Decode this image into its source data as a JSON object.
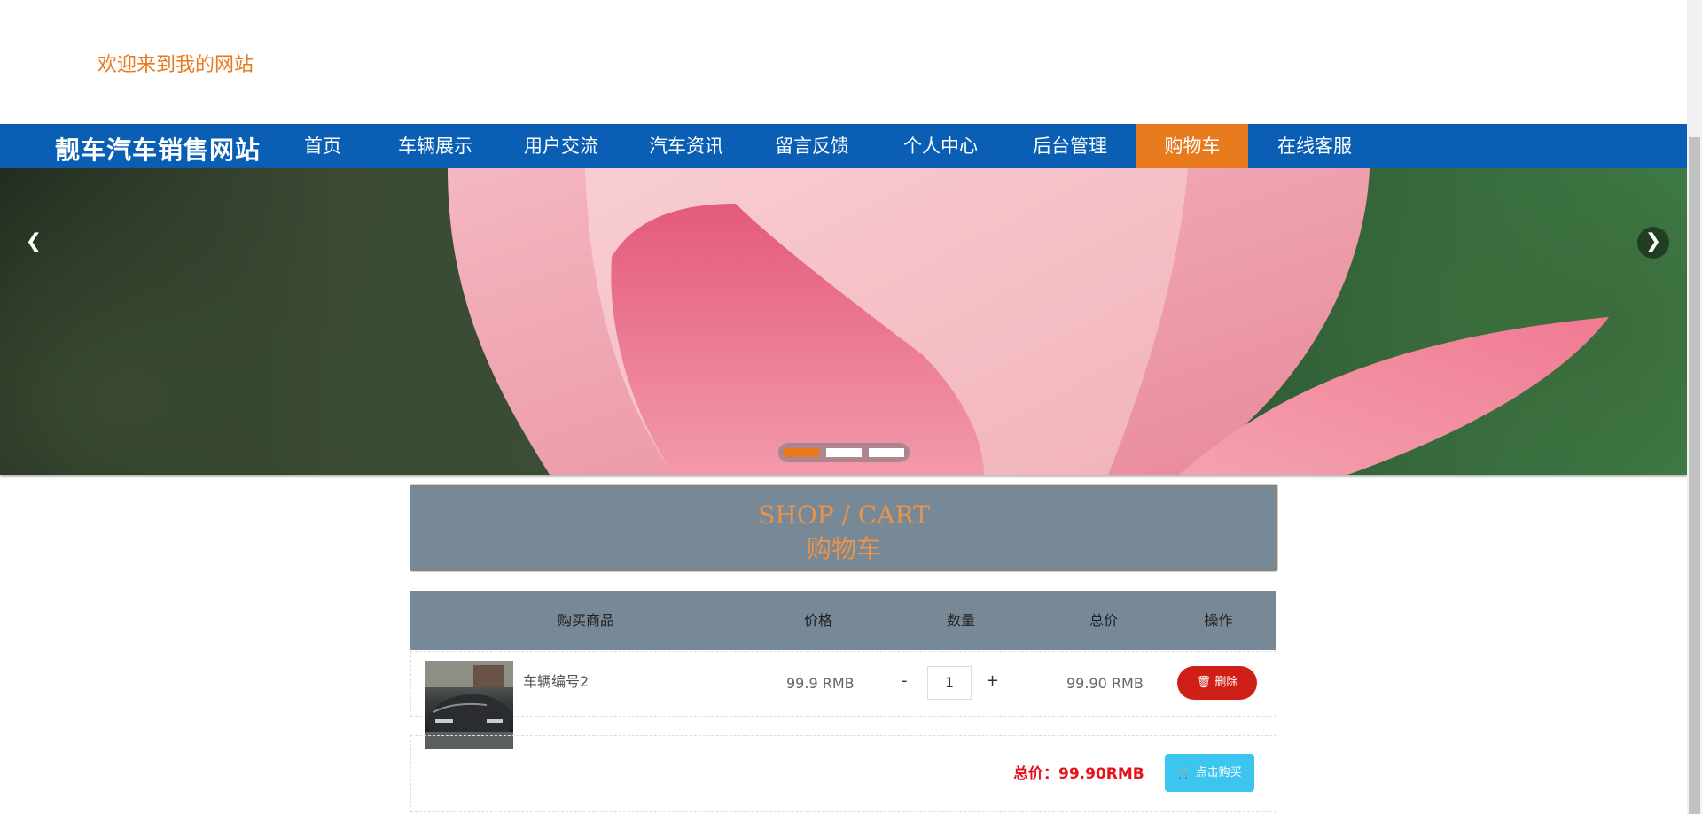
{
  "header": {
    "welcome": "欢迎来到我的网站"
  },
  "nav": {
    "brand": "靓车汽车销售网站",
    "items": [
      {
        "label": "首页"
      },
      {
        "label": "车辆展示"
      },
      {
        "label": "用户交流"
      },
      {
        "label": "汽车资讯"
      },
      {
        "label": "留言反馈"
      },
      {
        "label": "个人中心"
      },
      {
        "label": "后台管理"
      },
      {
        "label": "购物车",
        "active": true
      },
      {
        "label": "在线客服"
      }
    ]
  },
  "banner": {
    "prev_icon": "chevron-left-icon",
    "next_icon": "chevron-right-icon",
    "slides": 3,
    "active_slide": 1
  },
  "cart": {
    "title_en": "SHOP / CART",
    "title_cn": "购物车",
    "columns": [
      "购买商品",
      "价格",
      "数量",
      "总价",
      "操作"
    ],
    "items": [
      {
        "name": "车辆编号2",
        "price": "99.9 RMB",
        "qty_minus": "-",
        "quantity": "1",
        "qty_plus": "+",
        "subtotal": "99.90 RMB",
        "delete_label": "删除"
      }
    ],
    "total": "总价：99.90RMB",
    "buy_label": "点击购买"
  },
  "colors": {
    "accent": "#e87a1e",
    "nav_bg": "#0a5fb4",
    "header_bg": "#778897",
    "delete": "#d01f16",
    "buy": "#3cc5ee",
    "total": "#e8111a"
  }
}
